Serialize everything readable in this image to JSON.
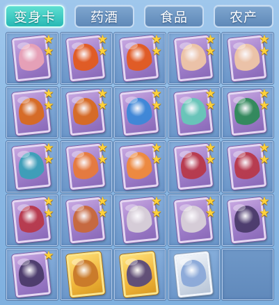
{
  "tabs": [
    {
      "label": "变身卡",
      "active": true,
      "name": "tab-transform-card"
    },
    {
      "label": "药酒",
      "active": false,
      "name": "tab-medicine-wine"
    },
    {
      "label": "食品",
      "active": false,
      "name": "tab-food"
    },
    {
      "label": "农产",
      "active": false,
      "name": "tab-farm-produce"
    }
  ],
  "colors": {
    "active_tab": "#27b8b4",
    "inactive_tab": "#5f89b8",
    "slot_bg": "#7aa3d2",
    "star": "#ffd23a"
  },
  "slots": [
    {
      "card": "purple",
      "art": "#e9a2b6",
      "stars": 2,
      "name": "pink-creature-card"
    },
    {
      "card": "purple",
      "art": "#e35a1e",
      "stars": 2,
      "name": "fire-demon-card"
    },
    {
      "card": "purple",
      "art": "#e35a1e",
      "stars": 2,
      "name": "fire-demon-card"
    },
    {
      "card": "purple",
      "art": "#efc6a6",
      "stars": 2,
      "name": "pig-creature-card"
    },
    {
      "card": "purple",
      "art": "#efc6a6",
      "stars": 2,
      "name": "pig-creature-card"
    },
    {
      "card": "purple",
      "art": "#d86a1f",
      "stars": 2,
      "name": "phoenix-card"
    },
    {
      "card": "purple",
      "art": "#d86a1f",
      "stars": 2,
      "name": "phoenix-card"
    },
    {
      "card": "purple",
      "art": "#3b88d8",
      "stars": 2,
      "name": "blue-fairy-card"
    },
    {
      "card": "purple",
      "art": "#66c8b8",
      "stars": 2,
      "name": "green-spirit-card"
    },
    {
      "card": "purple",
      "art": "#2f8a58",
      "stars": 2,
      "name": "green-warrior-card"
    },
    {
      "card": "purple",
      "art": "#3aa0b8",
      "stars": 2,
      "name": "dragon-rider-card"
    },
    {
      "card": "purple",
      "art": "#e87a3a",
      "stars": 2,
      "name": "orange-monk-card"
    },
    {
      "card": "purple",
      "art": "#f08a3a",
      "stars": 2,
      "name": "flame-fox-card"
    },
    {
      "card": "purple",
      "art": "#b8384a",
      "stars": 2,
      "name": "red-bird-card"
    },
    {
      "card": "purple",
      "art": "#b8384a",
      "stars": 2,
      "name": "red-bird-card"
    },
    {
      "card": "purple",
      "art": "#b8384a",
      "stars": 2,
      "name": "crimson-bird-card"
    },
    {
      "card": "purple",
      "art": "#c8683a",
      "stars": 2,
      "name": "lion-warrior-card"
    },
    {
      "card": "purple",
      "art": "#d8d0d8",
      "stars": 2,
      "name": "winged-maiden-card"
    },
    {
      "card": "purple",
      "art": "#d8d0d8",
      "stars": 2,
      "name": "winged-maiden-card"
    },
    {
      "card": "purple",
      "art": "#4a3a6a",
      "stars": 2,
      "name": "dark-mage-card"
    },
    {
      "card": "purple",
      "art": "#4a3a6a",
      "stars": 1,
      "name": "dark-mage-card"
    },
    {
      "card": "gold",
      "art": "#c8782a",
      "stars": 0,
      "name": "gold-monkey-card"
    },
    {
      "card": "gold",
      "art": "#5a4a7a",
      "stars": 0,
      "name": "gold-sorcerer-card"
    },
    {
      "card": "silver",
      "art": "#8aa8d8",
      "stars": 0,
      "name": "silver-beast-card"
    },
    {
      "card": null,
      "art": null,
      "stars": 0,
      "name": "empty-slot"
    }
  ]
}
